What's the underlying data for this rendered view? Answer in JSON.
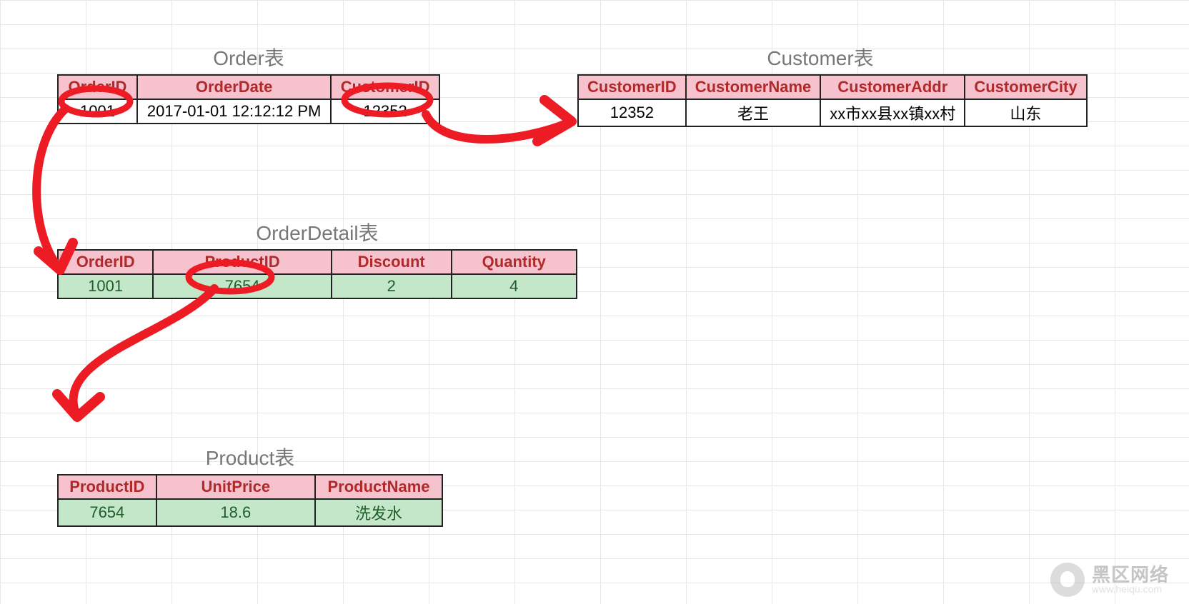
{
  "tables": {
    "order": {
      "title": "Order表",
      "headers": [
        "OrderID",
        "OrderDate",
        "CustomerID"
      ],
      "row": [
        "1001",
        "2017-01-01  12:12:12 PM",
        "12352"
      ]
    },
    "customer": {
      "title": "Customer表",
      "headers": [
        "CustomerID",
        "CustomerName",
        "CustomerAddr",
        "CustomerCity"
      ],
      "row": [
        "12352",
        "老王",
        "xx市xx县xx镇xx村",
        "山东"
      ]
    },
    "orderdetail": {
      "title": "OrderDetail表",
      "headers": [
        "OrderID",
        "ProductID",
        "Discount",
        "Quantity"
      ],
      "row": [
        "1001",
        "7654",
        "2",
        "4"
      ]
    },
    "product": {
      "title": "Product表",
      "headers": [
        "ProductID",
        "UnitPrice",
        "ProductName"
      ],
      "row": [
        "7654",
        "18.6",
        "洗发水"
      ]
    }
  },
  "watermark": {
    "main": "黑区网络",
    "sub": "www.heiqu.com"
  }
}
